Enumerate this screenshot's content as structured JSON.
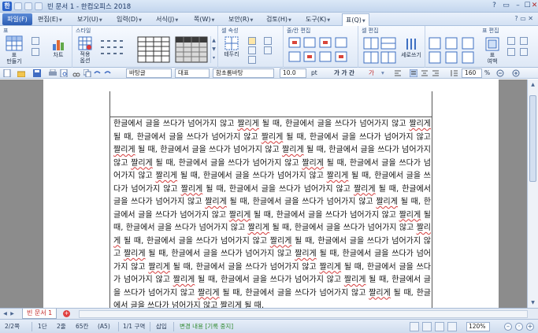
{
  "title_bar": {
    "title": "빈 문서 1 - 한컴오피스 2018",
    "app_icon": "hwp-app-icon",
    "buttons": [
      "?",
      "▭",
      "–",
      "☐",
      "✕"
    ]
  },
  "menu": {
    "file": "파일(F)",
    "items": [
      "편집(E)",
      "보기(U)",
      "입력(D)",
      "서식(J)",
      "쪽(W)",
      "보안(R)",
      "검토(H)",
      "도구(K)"
    ],
    "active_tab": "표(Q)",
    "right": "? ▭ ✕"
  },
  "ribbon": {
    "groups": {
      "table": "표",
      "style": "스타일",
      "cell_attr": "셀 속성",
      "row_col": "줄/칸 편집",
      "cell_edit": "셀 편집",
      "table_edit": "표 편집"
    },
    "buttons": {
      "make_table": "표\n만들기",
      "chart": "차트",
      "apply_options": "적용\n옵션",
      "border": "테두리",
      "sort": "세로쓰기",
      "table_props": "표\n여백"
    }
  },
  "format_bar": {
    "style": "바탕글",
    "lang": "대표",
    "font": "함초롬바탕",
    "size": "10.0",
    "unit": "pt",
    "bold_italic": "가 가 간",
    "zoom": "160",
    "zoom_unit": "%"
  },
  "document": {
    "underlined_word": "짤리게",
    "lines": [
      "한글에서 글을 쓰다가 넘어가지 않고 ",
      "짤리게",
      " 될 때, 한글에서 글을 쓰다가 넘어가지 않고 ",
      "짤리게",
      " 될 때, 한글에서 글을 쓰다가 넘어가지 않고 ",
      "짤리게",
      " 될 때, 한글에서 글을 쓰다가 넘어가지 않고 ",
      "짤리게",
      " 될 때, 한글에서 글을 쓰다가 넘어가지 않고 ",
      "짤리게",
      " 될 때, 한글에서 글을 쓰다가 넘어가지 않고 ",
      "짤리게",
      " 될 때, 한글에서 글을 쓰다가 넘어가지 않고 ",
      "짤리게",
      " 될 때, 한글에서 글을 쓰다가 넘어가지 않고 ",
      "짤리게",
      " 될 때, 한글에서 글을 쓰다가 넘어가지 않고 ",
      "짤리게",
      " 될 때, 한글에서 글을 쓰다가 넘어가지 않고 ",
      "짤리게",
      " 될 때, 한글에서 글을 쓰다가 넘어가지 않고 ",
      "짤리게",
      " 될 때, 한글에서 글을 쓰다가 넘어가지 않고 ",
      "짤리게",
      " 될 때, 한글에서 글을 쓰다가 넘어가지 않고 ",
      "짤리게",
      " 될 때, 한글에서 글을 쓰다가 넘어가지 않고 ",
      "짤리게",
      " 될 때, 한글에서 글을 쓰다가 넘어가지 않고 ",
      "짤리게",
      " 될 때, 한글에서 글을 쓰다가 넘어가지 않고 ",
      "짤리게",
      " 될 때, 한글에서 글을 쓰다가 넘어가지 않고 ",
      "짤리게",
      " 될 때, 한글에서 글을 쓰다가 넘어가지 않고 ",
      "짤리게",
      " 될 때, 한글에서 글을 쓰다가 넘어가지 않고 ",
      "짤리게",
      " 될 때, 한글에서 글을 쓰다가 넘어가지 않고 ",
      "짤리게",
      " 될 때, 한글에서 글을 쓰다가 넘어가지 않고 ",
      "짤리게",
      " 될 때, 한글에서 글을 쓰다가 넘어가지 않고 ",
      "짤리게",
      " 될 때, 한글에서 글을 쓰다가 넘어가지 않고 ",
      "짤리게",
      " 될 때, 한글에서 글을 쓰다가 넘어가지 않고 ",
      "짤리게",
      " 될 때, 한글에서 글을 쓰다가 넘어가지 않고 ",
      "짤리게",
      " 될 때, 한글에서 글을 쓰다가 넘어가지 않고 ",
      "짤리게",
      " 될 때, 한글에서 글을 쓰다가 넘어가지 않고 ",
      "짤리게",
      " 될 때,"
    ]
  },
  "tabs": {
    "doc_tab": "빈 문서 1",
    "add": "+"
  },
  "status": {
    "page": "2/2쪽",
    "section": "1단",
    "line": "2줄",
    "col": "65칸",
    "mode": "(A5)",
    "zone": "1/1 구역",
    "insert": "삽입",
    "track": "변경 내용 [기록 중지]",
    "zoom": "120%"
  }
}
